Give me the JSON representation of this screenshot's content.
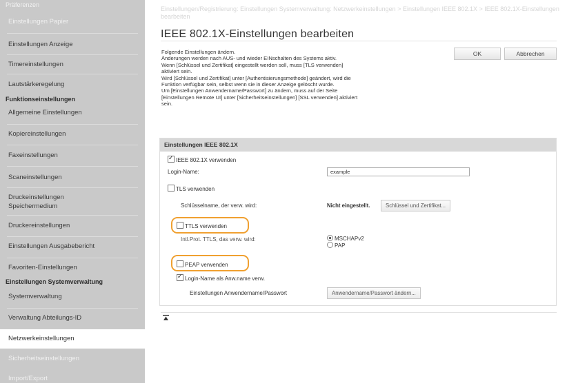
{
  "sidebar": {
    "top_header": "Präferenzen",
    "items_top": [
      "Einstellungen Papier",
      "Einstellungen Anzeige",
      "Timereinstellungen",
      "Lautstärkeregelung"
    ],
    "header_functions": "Funktionseinstellungen",
    "items_functions": [
      "Allgemeine Einstellungen",
      "Kopiereinstellungen",
      "Faxeinstellungen",
      "Scaneinstellungen",
      "Druckeinstellungen Speichermedium",
      "Druckereinstellungen",
      "Einstellungen Ausgabebericht",
      "Favoriten-Einstellungen"
    ],
    "header_system": "Einstellungen Systemverwaltung",
    "items_system": [
      "Systemverwaltung",
      "Verwaltung Abteilungs-ID",
      "Netzwerkeinstellungen",
      "Sicherheitseinstellungen",
      "Import/Export"
    ]
  },
  "breadcrumb": "Einstellungen/Registrierung: Einstellungen Systemverwaltung: Netzwerkeinstellungen > Einstellungen IEEE 802.1X > IEEE 802.1X-Einstellungen bearbeiten",
  "page_title": "IEEE 802.1X-Einstellungen bearbeiten",
  "description": [
    "Folgende Einstellungen ändern.",
    "Änderungen werden nach AUS- und wieder EINschalten des Systems aktiv.",
    "Wenn [Schlüssel und Zertifikat] eingestellt werden soll, muss [TLS verwenden]",
    "aktiviert sein.",
    "Wird [Schlüssel und Zertifikat] unter [Authentisierungsmethode] geändert, wird die",
    "Funktion verfügbar sein, selbst wenn sie in dieser Anzeige gelöscht wurde.",
    "Um [Einstellungen Anwendername/Passwort] zu ändern, muss auf der Seite",
    "[Einstellungen Remote UI] unter [Sicherheitseinstellungen] [SSL verwenden] aktiviert",
    "sein."
  ],
  "buttons": {
    "ok": "OK",
    "cancel": "Abbrechen"
  },
  "settings": {
    "section_title": "Einstellungen IEEE 802.1X",
    "use_ieee": "IEEE 802.1X verwenden",
    "login_name_label": "Login-Name:",
    "login_name_value": "example",
    "use_tls": "TLS verwenden",
    "key_name_label": "Schlüsselname, der verw. wird:",
    "key_name_value": "Nicht eingestellt.",
    "key_cert_button": "Schlüssel und Zertifikat...",
    "use_ttls": "TTLS verwenden",
    "inner_label": "Intl.Prot. TTLS, das verw. wird:",
    "radio_mschap": "MSCHAPv2",
    "radio_pap": "PAP",
    "use_peap": "PEAP verwenden",
    "login_as_user": "Login-Name als Anw.name verw.",
    "user_pass_label": "Einstellungen Anwendername/Passwort",
    "user_pass_button": "Anwendername/Passwort ändern..."
  },
  "colors": {
    "highlight": "#f0a030",
    "sidebar_bg": "#c9c9c9"
  },
  "top_icon": "scroll-top-icon"
}
